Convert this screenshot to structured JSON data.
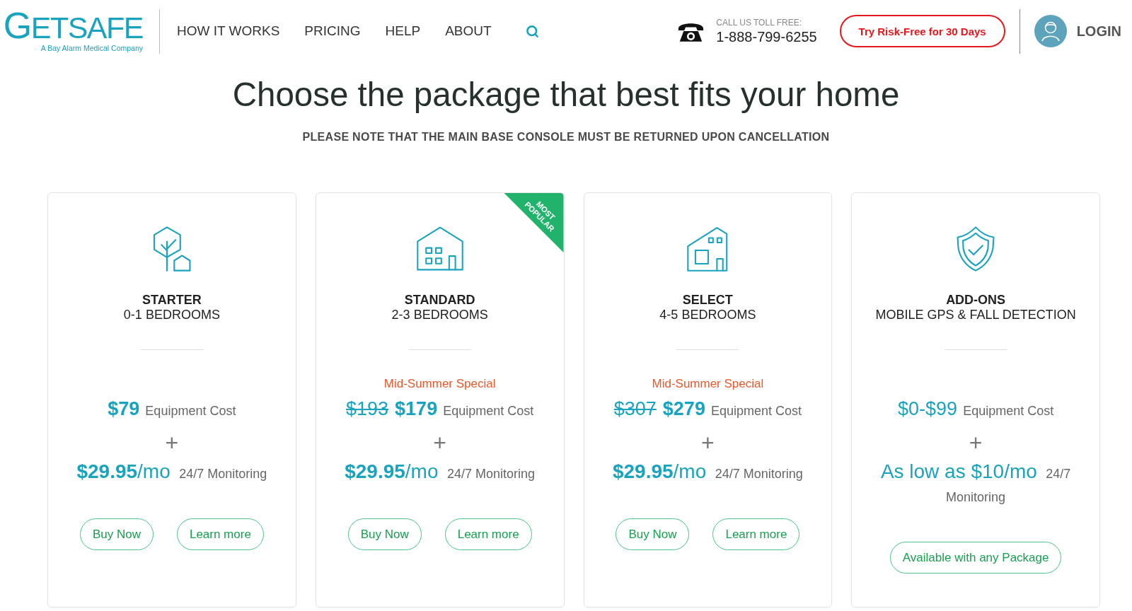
{
  "header": {
    "logo": "GETSAFE",
    "tagline": "A Bay Alarm Medical Company",
    "nav": [
      {
        "label": "HOW IT WORKS"
      },
      {
        "label": "PRICING"
      },
      {
        "label": "HELP"
      },
      {
        "label": "ABOUT"
      }
    ],
    "phone": {
      "caption": "CALL US TOLL FREE:",
      "number": "1-888-799-6255"
    },
    "cta": "Try Risk-Free for 30 Days",
    "login": "LOGIN"
  },
  "intro": {
    "title": "Choose the package that best fits your home",
    "note": "PLEASE NOTE THAT THE MAIN BASE CONSOLE MUST BE RETURNED UPON CANCELLATION"
  },
  "packages": [
    {
      "kind": "plan",
      "name": "STARTER",
      "subtitle": "0-1 BEDROOMS",
      "price": "$79",
      "price_caption": "Equipment Cost",
      "plus": "+",
      "monthly": "**$29.95**/mo",
      "monthly_caption": "24/7 Monitoring",
      "buttons": [
        "Buy Now",
        "Learn more"
      ]
    },
    {
      "kind": "plan",
      "name": "STANDARD",
      "subtitle": "2-3 BEDROOMS",
      "badge": "MOST POPULAR",
      "promo": "Mid-Summer Special",
      "old_price": "$193",
      "price": "$179",
      "price_caption": "Equipment Cost",
      "plus": "+",
      "monthly": "**$29.95**/mo",
      "monthly_caption": "24/7 Monitoring",
      "buttons": [
        "Buy Now",
        "Learn more"
      ]
    },
    {
      "kind": "plan",
      "name": "SELECT",
      "subtitle": "4-5 BEDROOMS",
      "promo": "Mid-Summer Special",
      "old_price": "$307",
      "price": "$279",
      "price_caption": "Equipment Cost",
      "plus": "+",
      "monthly": "**$29.95**/mo",
      "monthly_caption": "24/7 Monitoring",
      "buttons": [
        "Buy Now",
        "Learn more"
      ]
    },
    {
      "kind": "addon",
      "name": "ADD-ONS",
      "subtitle": "MOBILE GPS & FALL DETECTION",
      "price": "$0-$99",
      "price_caption": "Equipment Cost",
      "plus": "+",
      "monthly": "As low as $10/mo",
      "monthly_caption": "24/7 Monitoring",
      "buttons": [
        "Available with any Package"
      ]
    }
  ]
}
